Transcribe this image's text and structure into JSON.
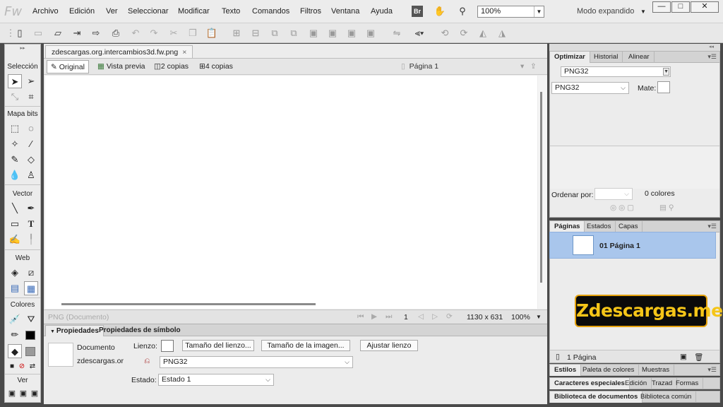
{
  "app": {
    "logo": "Fw"
  },
  "menu": [
    "Archivo",
    "Edición",
    "Ver",
    "Seleccionar",
    "Modificar",
    "Texto",
    "Comandos",
    "Filtros",
    "Ventana",
    "Ayuda"
  ],
  "topbar": {
    "bridge_label": "Br",
    "zoom_value": "100%",
    "workspace_mode": "Modo expandido"
  },
  "window_controls": {
    "minimize": "—",
    "maximize": "□",
    "close": "✕"
  },
  "tools": {
    "sections": [
      "Selección",
      "Mapa bits",
      "Vector",
      "Web",
      "Colores",
      "Ver"
    ]
  },
  "document": {
    "tab_title": "zdescargas.org.intercambios3d.fw.png",
    "tab_close": "×",
    "views": [
      "Original",
      "Vista previa",
      "2 copias",
      "4 copias"
    ],
    "page_selector": "Página 1",
    "status_left": "PNG (Documento)",
    "page_number": "1",
    "dimensions": "1130 x 631",
    "zoom": "100%"
  },
  "properties": {
    "tabs": [
      "Propiedades",
      "Propiedades de símbolo"
    ],
    "doc_type_label": "Documento",
    "doc_name": "zdescargas.or",
    "canvas_label": "Lienzo:",
    "canvas_size_button": "Tamaño del lienzo...",
    "image_size_button": "Tamaño de la imagen...",
    "fit_canvas_button": "Ajustar lienzo",
    "format_value": "PNG32",
    "state_label": "Estado:",
    "state_value": "Estado 1"
  },
  "optimize_panel": {
    "tabs": [
      "Optimizar",
      "Historial",
      "Alinear"
    ],
    "preset_value": "PNG32",
    "format_value": "PNG32",
    "matte_label": "Mate:",
    "sort_label": "Ordenar por:",
    "colors_count": "0 colores"
  },
  "pages_panel": {
    "tabs": [
      "Páginas",
      "Estados",
      "Capas"
    ],
    "page_label": "01  Página 1",
    "watermark": "Zdescargas.me",
    "page_count": "1 Página"
  },
  "bottom_panels": {
    "row1": [
      "Estilos",
      "Paleta de colores",
      "Muestras"
    ],
    "row2": [
      "Caracteres especiales",
      "Edición",
      "Trazad",
      "Formas"
    ],
    "row3": [
      "Biblioteca de documentos",
      "Biblioteca común"
    ]
  }
}
